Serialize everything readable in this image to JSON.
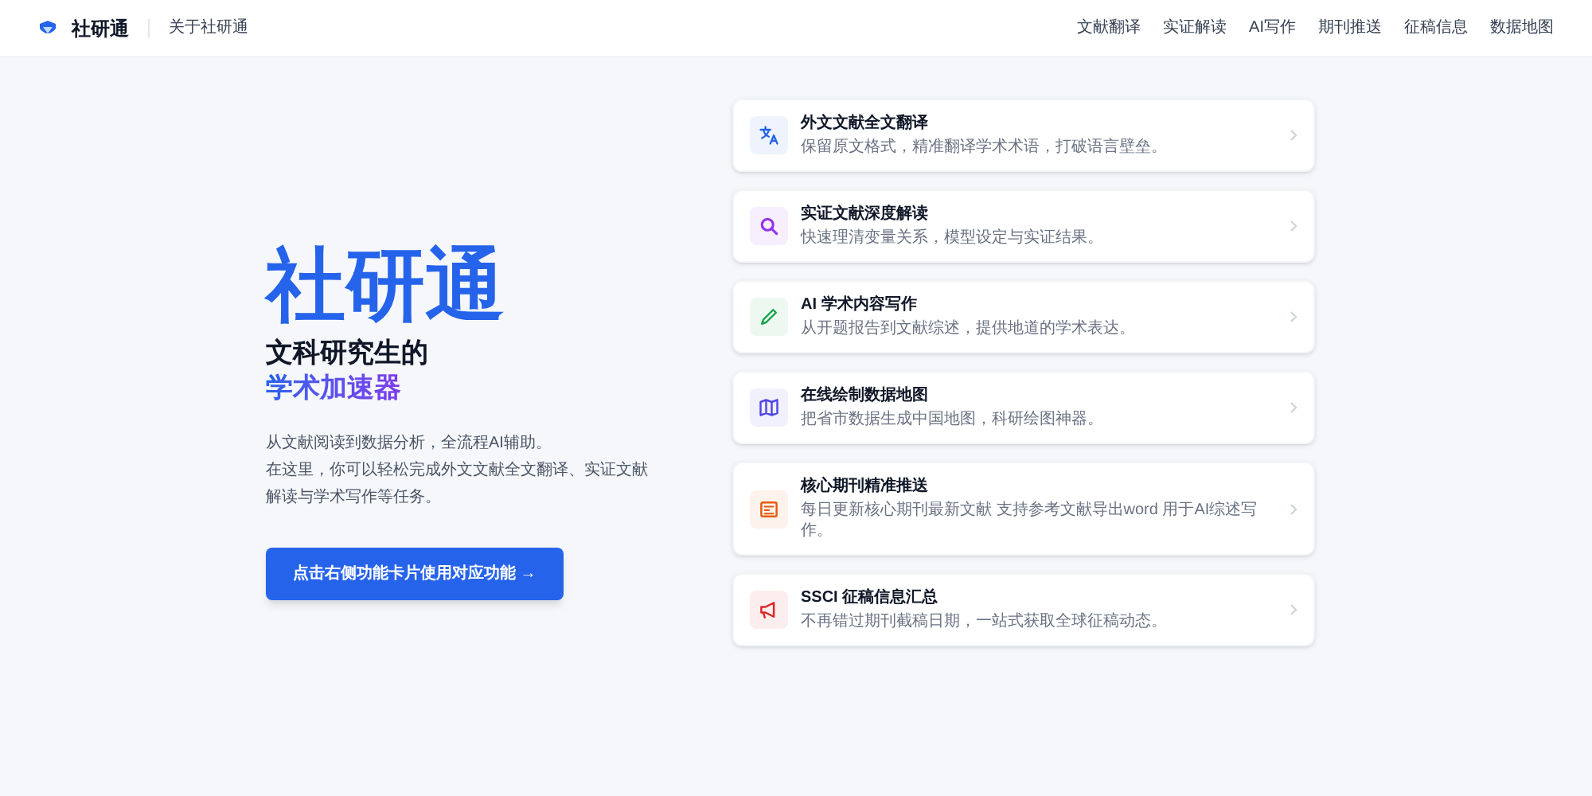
{
  "header": {
    "brand": "社研通",
    "about_link": "关于社研通",
    "nav": [
      "文献翻译",
      "实证解读",
      "AI写作",
      "期刊推送",
      "征稿信息",
      "数据地图"
    ]
  },
  "hero": {
    "title": "社研通",
    "subtitle_line1": "文科研究生的",
    "subtitle_line2": "学术加速器",
    "paragraph_line1": "从文献阅读到数据分析，全流程AI辅助。",
    "paragraph_line2": "在这里，你可以轻松完成外文文献全文翻译、实证文献解读与学术写作等任务。",
    "cta": "点击右侧功能卡片使用对应功能 →"
  },
  "features": [
    {
      "kind": "translate",
      "color": "#2563eb",
      "title": "外文文献全文翻译",
      "description": "保留原文格式，精准翻译学术术语，打破语言壁垒。"
    },
    {
      "kind": "search",
      "color": "#9333ea",
      "title": "实证文献深度解读",
      "description": "快速理清变量关系，模型设定与实证结果。"
    },
    {
      "kind": "pen",
      "color": "#16a34a",
      "title": "AI 学术内容写作",
      "description": "从开题报告到文献综述，提供地道的学术表达。"
    },
    {
      "kind": "map",
      "color": "#4f46e5",
      "title": "在线绘制数据地图",
      "description": "把省市数据生成中国地图，科研绘图神器。"
    },
    {
      "kind": "journal",
      "color": "#ea580c",
      "title": "核心期刊精准推送",
      "description": "每日更新核心期刊最新文献 支持参考文献导出word 用于AI综述写作。"
    },
    {
      "kind": "megaphone",
      "color": "#dc2626",
      "title": "SSCI 征稿信息汇总",
      "description": "不再错过期刊截稿日期，一站式获取全球征稿动态。"
    }
  ]
}
